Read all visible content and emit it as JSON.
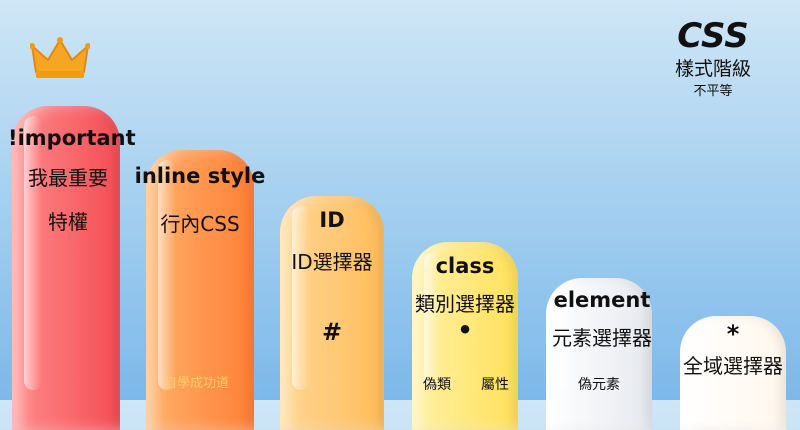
{
  "title": {
    "main": "CSS",
    "sub": "樣式階級",
    "note": "不平等"
  },
  "levels": [
    {
      "name": "!important",
      "desc1": "我最重要",
      "desc2": "特權"
    },
    {
      "name": "inline style",
      "desc1": "行內CSS"
    },
    {
      "name": "ID",
      "desc1": "ID選擇器",
      "symbol": "#"
    },
    {
      "name": "class",
      "desc1": "類別選擇器",
      "symbol": "•",
      "notes": [
        "偽類",
        "屬性"
      ]
    },
    {
      "name": "element",
      "desc1": "元素選擇器",
      "notes": [
        "偽元素"
      ]
    },
    {
      "name": "*",
      "desc1": "全域選擇器"
    }
  ],
  "watermark": "自學成功道",
  "icons": {
    "crown": "crown-icon"
  },
  "colors": {
    "level1": "#f44d55",
    "level2": "#ff7f36",
    "level3": "#ffbd5a",
    "level4": "#ffe15a",
    "level5": "#e6e9ee",
    "level6": "#fff7ec",
    "crown": "#f6a623"
  }
}
